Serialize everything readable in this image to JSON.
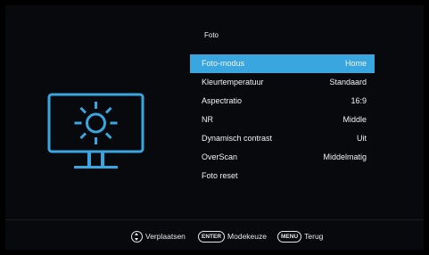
{
  "header": {
    "title": "Foto"
  },
  "menu": {
    "items": [
      {
        "label": "Foto-modus",
        "value": "Home",
        "selected": true
      },
      {
        "label": "Kleurtemperatuur",
        "value": "Standaard",
        "selected": false
      },
      {
        "label": "Aspectratio",
        "value": "16:9",
        "selected": false
      },
      {
        "label": "NR",
        "value": "Middle",
        "selected": false
      },
      {
        "label": "Dynamisch contrast",
        "value": "Uit",
        "selected": false
      },
      {
        "label": "OverScan",
        "value": "Middelmatig",
        "selected": false
      },
      {
        "label": "Foto reset",
        "value": "",
        "selected": false
      }
    ]
  },
  "footer": {
    "move_label": "Verplaatsen",
    "enter_key": "ENTER",
    "enter_label": "Modekeuze",
    "menu_key": "MENU",
    "menu_label": "Terug"
  },
  "colors": {
    "accent": "#3aa6e0",
    "background": "#07090d",
    "text": "#f4f4f4"
  },
  "icons": {
    "category": "monitor-brightness-icon"
  }
}
